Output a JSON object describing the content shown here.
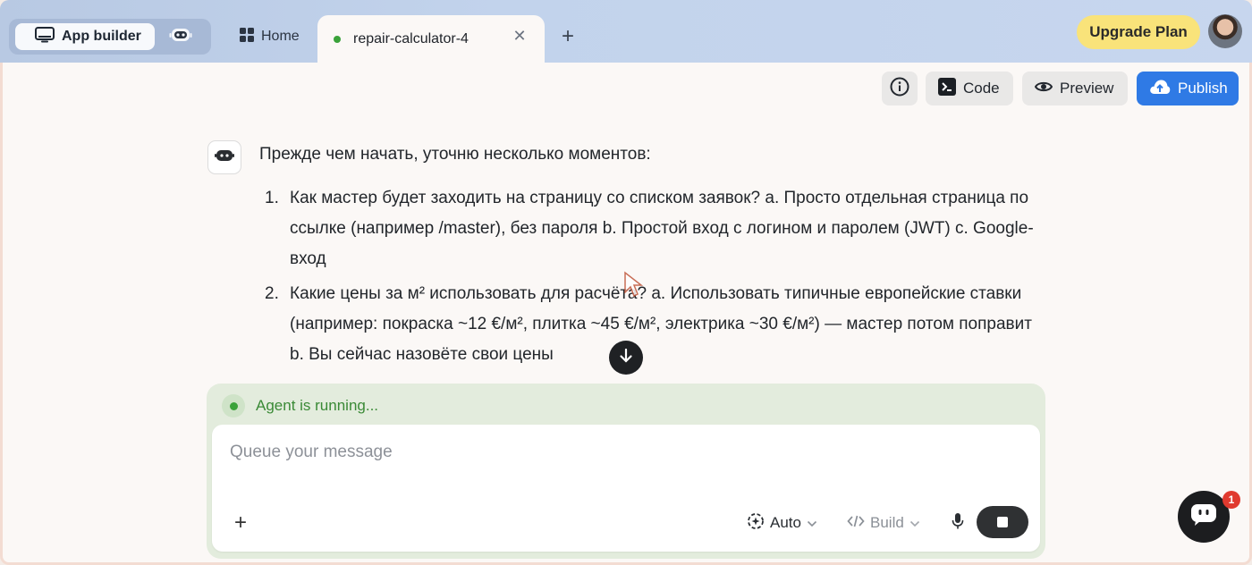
{
  "header": {
    "mode_switch": {
      "app_builder_label": "App builder"
    },
    "tabs": [
      {
        "label": "Home"
      },
      {
        "label": "repair-calculator-4",
        "active": true,
        "status_color": "#3aa23a"
      }
    ],
    "add_tab_icon": "plus-icon",
    "upgrade_label": "Upgrade Plan"
  },
  "toolbar": {
    "info_icon": "info-icon",
    "code_label": "Code",
    "preview_label": "Preview",
    "publish_label": "Publish",
    "publish_color": "#2f7ae5"
  },
  "chat": {
    "intro": "Прежде чем начать, уточню несколько моментов:",
    "items": [
      {
        "num": "1.",
        "text": "Как мастер будет заходить на страницу со списком заявок? a. Просто отдельная страница по ссылке (например /master), без пароля b. Простой вход с логином и паролем (JWT) c. Google-вход"
      },
      {
        "num": "2.",
        "text": "Какие цены за м² использовать для расчёта? a. Использовать типичные европейские ставки (например: покраска ~12 €/м², плитка ~45 €/м², электрика ~30 €/м²) — мастер потом поправит b. Вы сейчас назовёте свои цены"
      }
    ]
  },
  "composer": {
    "status_text": "Agent is running...",
    "status_color": "#3a8a36",
    "placeholder": "Queue your message",
    "value": "",
    "auto_label": "Auto",
    "build_label": "Build"
  },
  "floating_chat": {
    "badge_count": "1",
    "badge_color": "#e03a2f"
  }
}
